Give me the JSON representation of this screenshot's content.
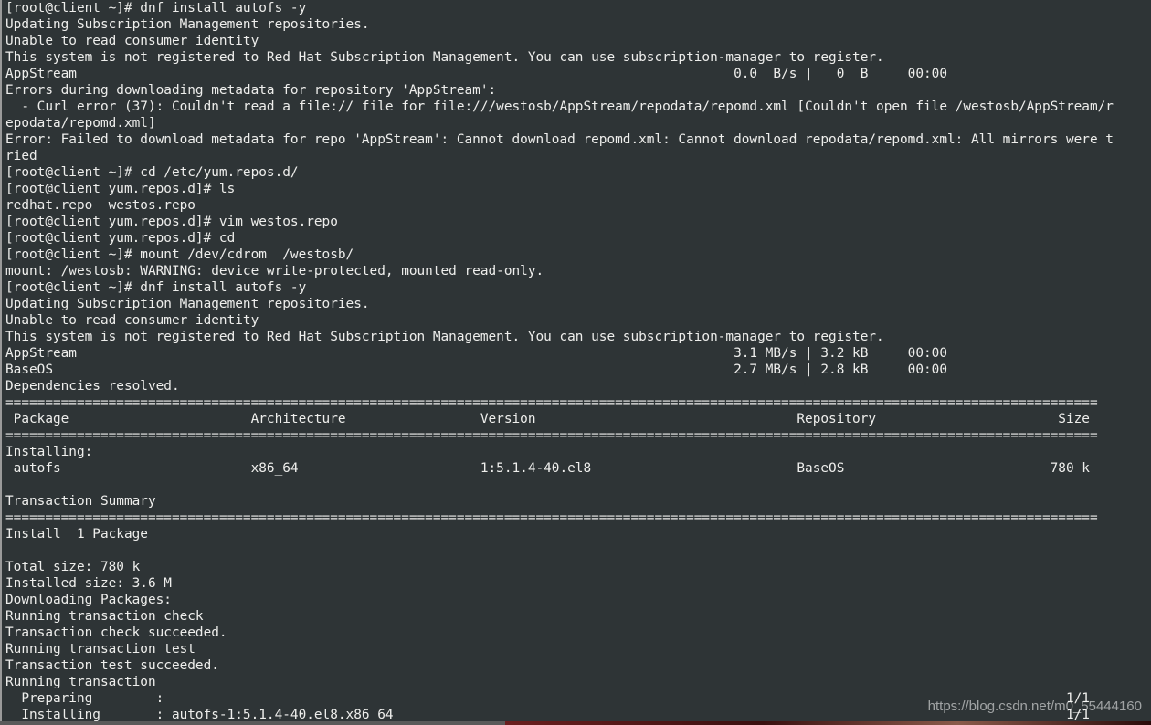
{
  "terminal": {
    "lines": [
      "[root@client ~]# dnf install autofs -y",
      "Updating Subscription Management repositories.",
      "Unable to read consumer identity",
      "This system is not registered to Red Hat Subscription Management. You can use subscription-manager to register.",
      "AppStream                                                                                   0.0  B/s |   0  B     00:00",
      "Errors during downloading metadata for repository 'AppStream':",
      "  - Curl error (37): Couldn't read a file:// file for file:///westosb/AppStream/repodata/repomd.xml [Couldn't open file /westosb/AppStream/r",
      "epodata/repomd.xml]",
      "Error: Failed to download metadata for repo 'AppStream': Cannot download repomd.xml: Cannot download repodata/repomd.xml: All mirrors were t",
      "ried",
      "[root@client ~]# cd /etc/yum.repos.d/",
      "[root@client yum.repos.d]# ls",
      "redhat.repo  westos.repo",
      "[root@client yum.repos.d]# vim westos.repo",
      "[root@client yum.repos.d]# cd",
      "[root@client ~]# mount /dev/cdrom  /westosb/",
      "mount: /westosb: WARNING: device write-protected, mounted read-only.",
      "[root@client ~]# dnf install autofs -y",
      "Updating Subscription Management repositories.",
      "Unable to read consumer identity",
      "This system is not registered to Red Hat Subscription Management. You can use subscription-manager to register.",
      "AppStream                                                                                   3.1 MB/s | 3.2 kB     00:00",
      "BaseOS                                                                                      2.7 MB/s | 2.8 kB     00:00",
      "Dependencies resolved.",
      "==========================================================================================================================================",
      " Package                       Architecture                 Version                                 Repository                       Size",
      "==========================================================================================================================================",
      "Installing:",
      " autofs                        x86_64                       1:5.1.4-40.el8                          BaseOS                          780 k",
      "",
      "Transaction Summary",
      "==========================================================================================================================================",
      "Install  1 Package",
      "",
      "Total size: 780 k",
      "Installed size: 3.6 M",
      "Downloading Packages:",
      "Running transaction check",
      "Transaction check succeeded.",
      "Running transaction test",
      "Transaction test succeeded.",
      "Running transaction",
      "  Preparing        :                                                                                                                  1/1",
      "  Installing       : autofs-1:5.1.4-40.el8.x86_64                                                                                     1/1"
    ]
  },
  "watermark": "https://blog.csdn.net/m0_55444160",
  "colors": {
    "background": "#2e3436",
    "foreground": "#eeeeec"
  }
}
